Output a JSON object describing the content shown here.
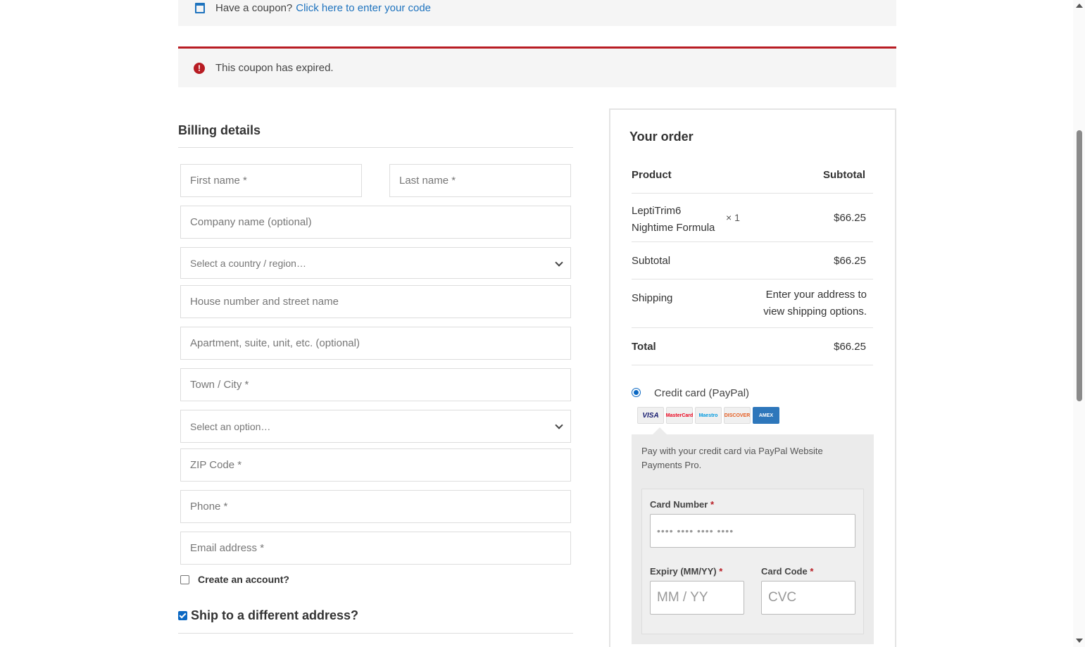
{
  "coupon_notice": {
    "text": "Have a coupon?",
    "link": "Click here to enter your code"
  },
  "error_notice": {
    "icon": "exclamation-icon",
    "text": "This coupon has expired."
  },
  "billing": {
    "title": "Billing details",
    "fields": {
      "first_name": "First name *",
      "last_name": "Last name *",
      "company": "Company name (optional)",
      "country": "Select a country / region…",
      "address1": "House number and street name",
      "address2": "Apartment, suite, unit, etc. (optional)",
      "city": "Town / City *",
      "state": "Select an option…",
      "zip": "ZIP Code *",
      "phone": "Phone *",
      "email": "Email address *"
    },
    "create_account": "Create an account?",
    "ship_different": "Ship to a different address?"
  },
  "order": {
    "title": "Your order",
    "header": {
      "product": "Product",
      "subtotal": "Subtotal"
    },
    "item": {
      "name_line1": "LeptiTrim6",
      "name_line2": "Nightime Formula",
      "qty": "× 1",
      "price": "$66.25"
    },
    "subtotal": {
      "label": "Subtotal",
      "value": "$66.25"
    },
    "shipping": {
      "label": "Shipping",
      "value_line1": "Enter your address to",
      "value_line2": "view shipping options."
    },
    "total": {
      "label": "Total",
      "value": "$66.25"
    }
  },
  "payment": {
    "method_label": "Credit card (PayPal)",
    "card_logos": [
      "VISA",
      "MasterCard",
      "Maestro",
      "DISCOVER",
      "AMEX"
    ],
    "description": "Pay with your credit card via PayPal Website Payments Pro.",
    "card_number_label": "Card Number",
    "card_number_placeholder": "•••• •••• •••• ••••",
    "expiry_label": "Expiry (MM/YY)",
    "expiry_placeholder": "MM / YY",
    "code_label": "Card Code",
    "code_placeholder": "CVC",
    "required_mark": "*"
  },
  "colors": {
    "link": "#1e73be",
    "error": "#b81c23",
    "accent": "#0b68c3"
  }
}
